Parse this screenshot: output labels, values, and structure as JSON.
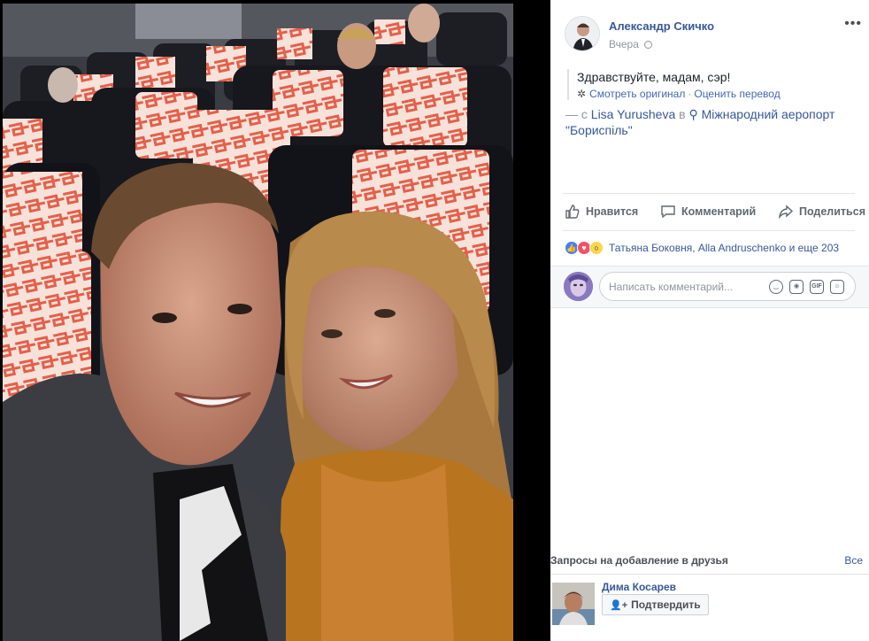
{
  "post": {
    "author": "Александр Скичко",
    "time": "Вчера",
    "text": "Здравствуйте, мадам, сэр!",
    "see_original": "Смотреть оригинал",
    "rate_translation": "Оценить перевод",
    "with_prefix": "— с",
    "tagged_user": "Lisa Yurusheva",
    "in_word": "в",
    "location": "Міжнародний аеропорт \"Бориспіль\"",
    "more_icon": "ellipsis-icon"
  },
  "actions": {
    "like": "Нравится",
    "comment": "Комментарий",
    "share": "Поделиться"
  },
  "reactions": {
    "summary": "Татьяна Боковня, Alla Andruschenko и еще 203",
    "types": [
      "like",
      "love",
      "wow"
    ]
  },
  "comment": {
    "placeholder": "Написать комментарий..."
  },
  "friend_requests": {
    "title": "Запросы на добавление в друзья",
    "see_all": "Все",
    "items": [
      {
        "name": "Дима Косарев",
        "confirm": "Подтвердить"
      }
    ]
  },
  "colors": {
    "link": "#365899",
    "seat_dark": "#1b1d22",
    "seat_headrest": "#f6d8ce",
    "seat_pattern": "#e4604a"
  }
}
